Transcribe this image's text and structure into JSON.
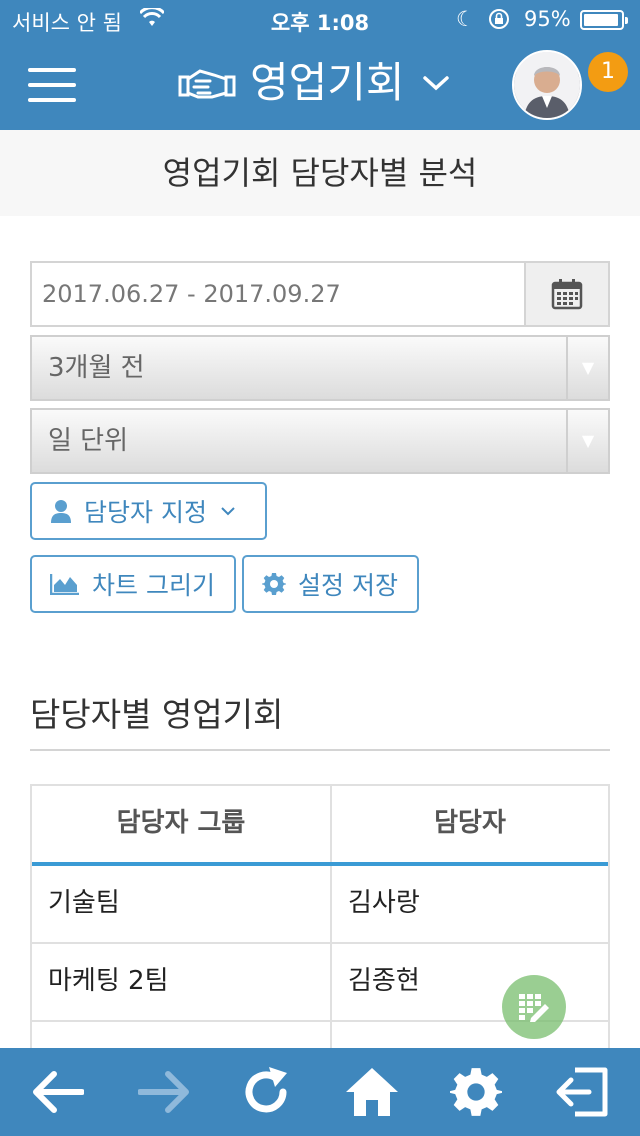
{
  "status_bar": {
    "carrier": "서비스 안 됨",
    "time": "오후 1:08",
    "battery_percent": "95%",
    "battery_level": 0.95
  },
  "header": {
    "title": "영업기회",
    "notification_count": "1"
  },
  "page_title": "영업기회 담당자별 분석",
  "filters": {
    "date_range": "2017.06.27 - 2017.09.27",
    "period_select": "3개월 전",
    "unit_select": "일 단위",
    "assign_button": "담당자 지정",
    "chart_button": "차트 그리기",
    "save_button": "설정 저장"
  },
  "section": {
    "title": "담당자별 영업기회"
  },
  "table": {
    "headers": [
      "담당자 그룹",
      "담당자"
    ],
    "rows": [
      [
        "기술팀",
        "김사랑"
      ],
      [
        "마케팅 2팀",
        "김종현"
      ]
    ]
  },
  "colors": {
    "header_bg": "#3f87bd",
    "accent": "#3a9bd5",
    "badge": "#f39c12"
  },
  "icons": {
    "toolbar": [
      "back-arrow-icon",
      "forward-arrow-icon",
      "refresh-icon",
      "home-icon",
      "gear-icon",
      "logout-icon"
    ]
  }
}
